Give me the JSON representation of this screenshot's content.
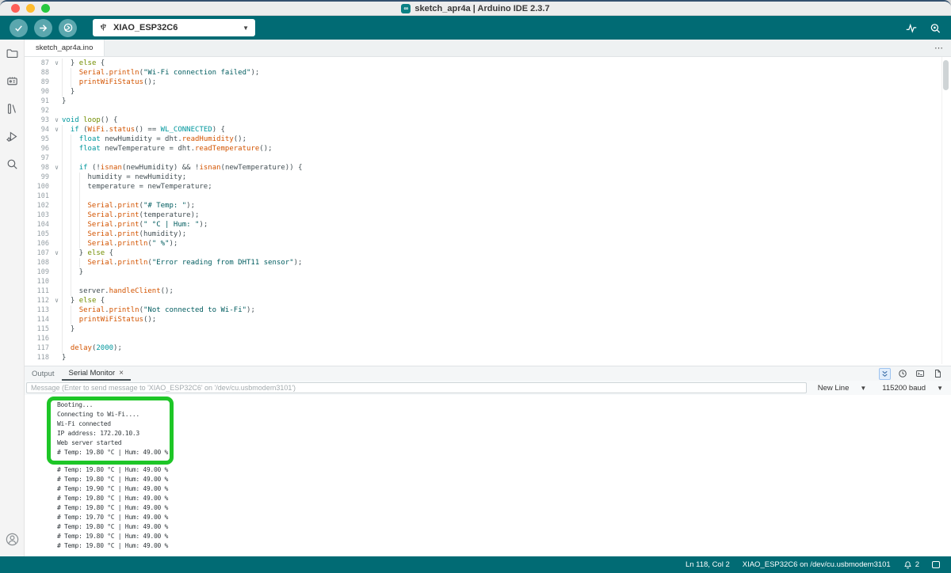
{
  "window": {
    "title": "sketch_apr4a | Arduino IDE 2.3.7"
  },
  "toolbar": {
    "verify": "verify",
    "upload": "upload",
    "debug": "debug",
    "board": "XIAO_ESP32C6",
    "right_icons": [
      "serial-plotter",
      "serial-monitor"
    ]
  },
  "sidebar": {
    "icons": [
      "sketchbook",
      "boards-manager",
      "library-manager",
      "debug",
      "search"
    ],
    "account": "account"
  },
  "editor": {
    "tab": "sketch_apr4a.ino",
    "first_line": 87,
    "folds": [
      87,
      93,
      94,
      98,
      107,
      112
    ],
    "code": [
      "  } else {",
      "    Serial.println(\"Wi-Fi connection failed\");",
      "    printWiFiStatus();",
      "  }",
      "}",
      "",
      "void loop() {",
      "  if (WiFi.status() == WL_CONNECTED) {",
      "    float newHumidity = dht.readHumidity();",
      "    float newTemperature = dht.readTemperature();",
      "",
      "    if (!isnan(newHumidity) && !isnan(newTemperature)) {",
      "      humidity = newHumidity;",
      "      temperature = newTemperature;",
      "",
      "      Serial.print(\"# Temp: \");",
      "      Serial.print(temperature);",
      "      Serial.print(\" °C | Hum: \");",
      "      Serial.print(humidity);",
      "      Serial.println(\" %\");",
      "    } else {",
      "      Serial.println(\"Error reading from DHT11 sensor\");",
      "    }",
      "",
      "    server.handleClient();",
      "  } else {",
      "    Serial.println(\"Not connected to Wi-Fi\");",
      "    printWiFiStatus();",
      "  }",
      "",
      "  delay(2000);",
      "}"
    ]
  },
  "panel": {
    "tab_output": "Output",
    "tab_serial": "Serial Monitor",
    "input_placeholder": "Message (Enter to send message to 'XIAO_ESP32C6' on '/dev/cu.usbmodem3101')",
    "line_ending": "New Line",
    "baud": "115200 baud"
  },
  "serial": {
    "highlighted_count": 6,
    "lines": [
      "Booting...",
      "Connecting to Wi-Fi....",
      "Wi-Fi connected",
      "IP address: 172.20.10.3",
      "Web server started",
      "# Temp: 19.80 °C | Hum: 49.00 %",
      "# Temp: 19.80 °C | Hum: 49.00 %",
      "# Temp: 19.80 °C | Hum: 49.00 %",
      "# Temp: 19.90 °C | Hum: 49.00 %",
      "# Temp: 19.80 °C | Hum: 49.00 %",
      "# Temp: 19.80 °C | Hum: 49.00 %",
      "# Temp: 19.70 °C | Hum: 49.00 %",
      "# Temp: 19.80 °C | Hum: 49.00 %",
      "# Temp: 19.80 °C | Hum: 49.00 %",
      "# Temp: 19.80 °C | Hum: 49.00 %"
    ]
  },
  "status": {
    "position": "Ln 118, Col 2",
    "port": "XIAO_ESP32C6 on /dev/cu.usbmodem3101",
    "notifications": "2"
  },
  "colors": {
    "teal": "#016b74",
    "highlight_green": "#1ec627",
    "keyword": "#00979d",
    "function": "#d35400",
    "string": "#005c5f"
  }
}
